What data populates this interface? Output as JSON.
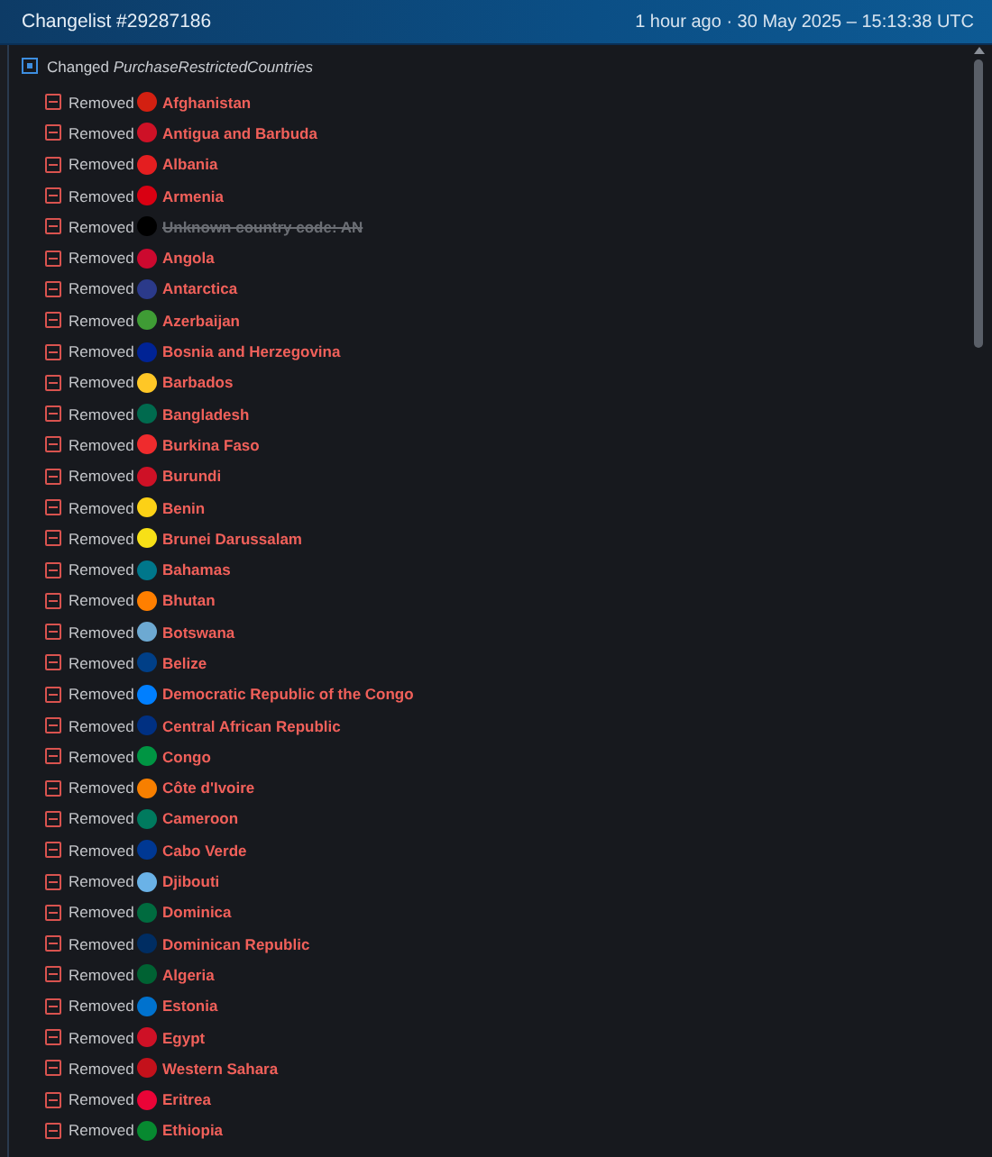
{
  "header": {
    "title": "Changelist #29287186",
    "timestamp": "1 hour ago · 30 May 2025 – 15:13:38 UTC"
  },
  "change": {
    "label": "Changed",
    "field": "PurchaseRestrictedCountries",
    "expanded": true
  },
  "items": [
    {
      "action": "Removed",
      "name": "Afghanistan",
      "kind": "country",
      "color": "#d32011"
    },
    {
      "action": "Removed",
      "name": "Antigua and Barbuda",
      "kind": "country",
      "color": "#ce1126"
    },
    {
      "action": "Removed",
      "name": "Albania",
      "kind": "country",
      "color": "#e41e20"
    },
    {
      "action": "Removed",
      "name": "Armenia",
      "kind": "country",
      "color": "#d90012"
    },
    {
      "action": "Removed",
      "name": "Unknown country code: AN",
      "kind": "unknown",
      "color": "#000000"
    },
    {
      "action": "Removed",
      "name": "Angola",
      "kind": "country",
      "color": "#cc092f"
    },
    {
      "action": "Removed",
      "name": "Antarctica",
      "kind": "country",
      "color": "#2b3a8a"
    },
    {
      "action": "Removed",
      "name": "Azerbaijan",
      "kind": "country",
      "color": "#3f9c35"
    },
    {
      "action": "Removed",
      "name": "Bosnia and Herzegovina",
      "kind": "country",
      "color": "#002395"
    },
    {
      "action": "Removed",
      "name": "Barbados",
      "kind": "country",
      "color": "#ffc726"
    },
    {
      "action": "Removed",
      "name": "Bangladesh",
      "kind": "country",
      "color": "#006a4e"
    },
    {
      "action": "Removed",
      "name": "Burkina Faso",
      "kind": "country",
      "color": "#ef2b2d"
    },
    {
      "action": "Removed",
      "name": "Burundi",
      "kind": "country",
      "color": "#ce1126"
    },
    {
      "action": "Removed",
      "name": "Benin",
      "kind": "country",
      "color": "#fcd116"
    },
    {
      "action": "Removed",
      "name": "Brunei Darussalam",
      "kind": "country",
      "color": "#f7e017"
    },
    {
      "action": "Removed",
      "name": "Bahamas",
      "kind": "country",
      "color": "#00778b"
    },
    {
      "action": "Removed",
      "name": "Bhutan",
      "kind": "country",
      "color": "#ff7f00"
    },
    {
      "action": "Removed",
      "name": "Botswana",
      "kind": "country",
      "color": "#6da9d2"
    },
    {
      "action": "Removed",
      "name": "Belize",
      "kind": "country",
      "color": "#003f87"
    },
    {
      "action": "Removed",
      "name": "Democratic Republic of the Congo",
      "kind": "country",
      "color": "#007fff"
    },
    {
      "action": "Removed",
      "name": "Central African Republic",
      "kind": "country",
      "color": "#003082"
    },
    {
      "action": "Removed",
      "name": "Congo",
      "kind": "country",
      "color": "#009543"
    },
    {
      "action": "Removed",
      "name": "Côte d'Ivoire",
      "kind": "country",
      "color": "#f77f00"
    },
    {
      "action": "Removed",
      "name": "Cameroon",
      "kind": "country",
      "color": "#007a5e"
    },
    {
      "action": "Removed",
      "name": "Cabo Verde",
      "kind": "country",
      "color": "#003893"
    },
    {
      "action": "Removed",
      "name": "Djibouti",
      "kind": "country",
      "color": "#6ab2e7"
    },
    {
      "action": "Removed",
      "name": "Dominica",
      "kind": "country",
      "color": "#006b3f"
    },
    {
      "action": "Removed",
      "name": "Dominican Republic",
      "kind": "country",
      "color": "#002d62"
    },
    {
      "action": "Removed",
      "name": "Algeria",
      "kind": "country",
      "color": "#006233"
    },
    {
      "action": "Removed",
      "name": "Estonia",
      "kind": "country",
      "color": "#0072ce"
    },
    {
      "action": "Removed",
      "name": "Egypt",
      "kind": "country",
      "color": "#ce1126"
    },
    {
      "action": "Removed",
      "name": "Western Sahara",
      "kind": "country",
      "color": "#c4111b"
    },
    {
      "action": "Removed",
      "name": "Eritrea",
      "kind": "country",
      "color": "#ea0437"
    },
    {
      "action": "Removed",
      "name": "Ethiopia",
      "kind": "country",
      "color": "#078930"
    }
  ]
}
